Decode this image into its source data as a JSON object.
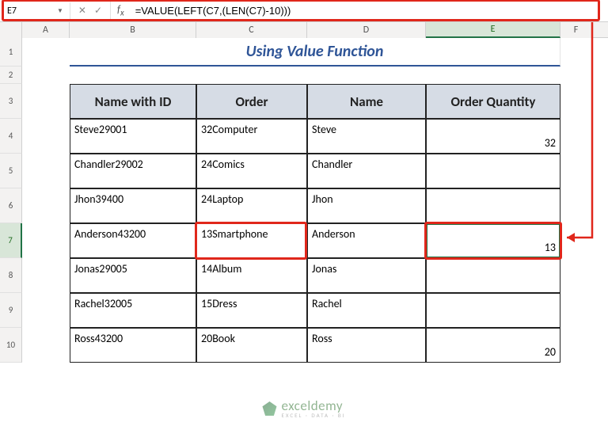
{
  "nameBox": "E7",
  "formula": "=VALUE(LEFT(C7,(LEN(C7)-10)))",
  "title": "Using Value Function",
  "columns": [
    "A",
    "B",
    "C",
    "D",
    "E",
    "F"
  ],
  "headers": {
    "b": "Name with ID",
    "c": "Order",
    "d": "Name",
    "e": "Order Quantity"
  },
  "rows": [
    {
      "b": "Steve29001",
      "c": "32Computer",
      "d": "Steve",
      "e": "32"
    },
    {
      "b": "Chandler29002",
      "c": "24Comics",
      "d": "Chandler",
      "e": ""
    },
    {
      "b": "Jhon39400",
      "c": "24Laptop",
      "d": "Jhon",
      "e": ""
    },
    {
      "b": "Anderson43200",
      "c": "13Smartphone",
      "d": "Anderson",
      "e": "13"
    },
    {
      "b": "Jonas29005",
      "c": "14Album",
      "d": "Jonas",
      "e": ""
    },
    {
      "b": "Rachel32005",
      "c": "15Dress",
      "d": "Rachel",
      "e": ""
    },
    {
      "b": "Ross43200",
      "c": "20Book",
      "d": "Ross",
      "e": "20"
    }
  ],
  "watermark": {
    "main": "exceldemy",
    "sub": "EXCEL · DATA · BI"
  }
}
